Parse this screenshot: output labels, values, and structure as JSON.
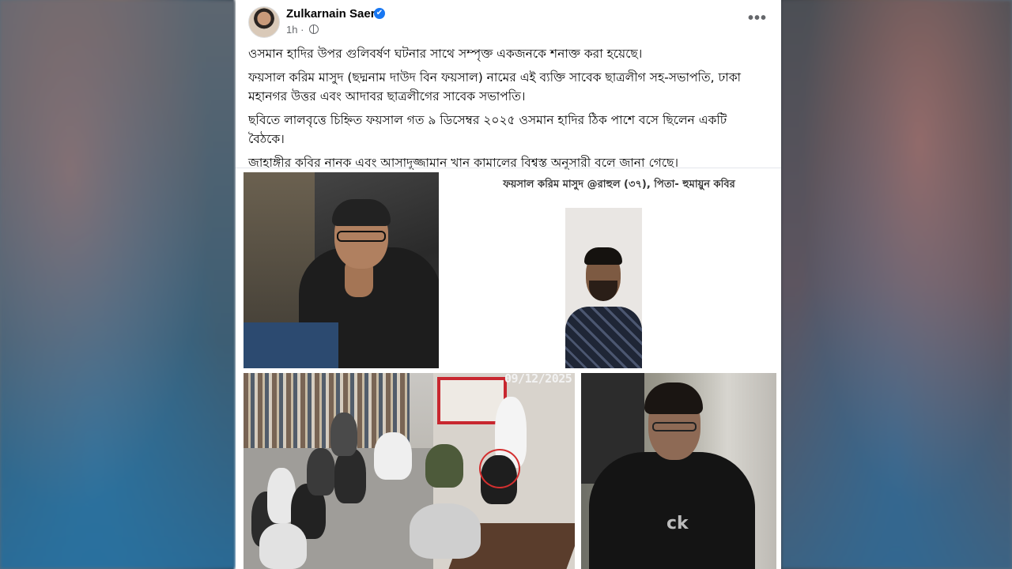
{
  "post": {
    "author_name": "Zulkarnain Saer",
    "verified_badge": "✔",
    "time": "1h",
    "separator": "·",
    "more_label": "•••",
    "paragraphs": [
      "ওসমান হাদির উপর গুলিবর্ষণ ঘটনার সাথে সম্পৃক্ত একজনকে শনাক্ত করা হয়েছে।",
      "ফয়সাল করিম মাসুদ (ছদ্মনাম দাউদ বিন ফয়সাল) নামের এই ব্যক্তি সাবেক ছাত্রলীগ সহ-সভাপতি, ঢাকা মহানগর উত্তর এবং আদাবর ছাত্রলীগের সাবেক সভাপতি।",
      "ছবিতে লালবৃত্তে চিহ্নিত ফয়সাল গত ৯ ডিসেম্বর ২০২৫ ওসমান হাদির ঠিক পাশে বসে ছিলেন একটি বৈঠকে।",
      "জাহাঙ্গীর কবির নানক এবং আসাদুজ্জামান খান কামালের বিশ্বস্ত অনুসারী বলে জানা গেছে।"
    ]
  },
  "images": {
    "caption": "ফয়সাল করিম মাসুদ @রাহুল (৩৭), পিতা- হুমায়ুন কবির",
    "cctv_timestamp": "09/12/2025",
    "hoodie_logo": "ck"
  },
  "colors": {
    "verified": "#1877f2",
    "circle_highlight": "#d32f2f",
    "meta_text": "#65676b"
  }
}
